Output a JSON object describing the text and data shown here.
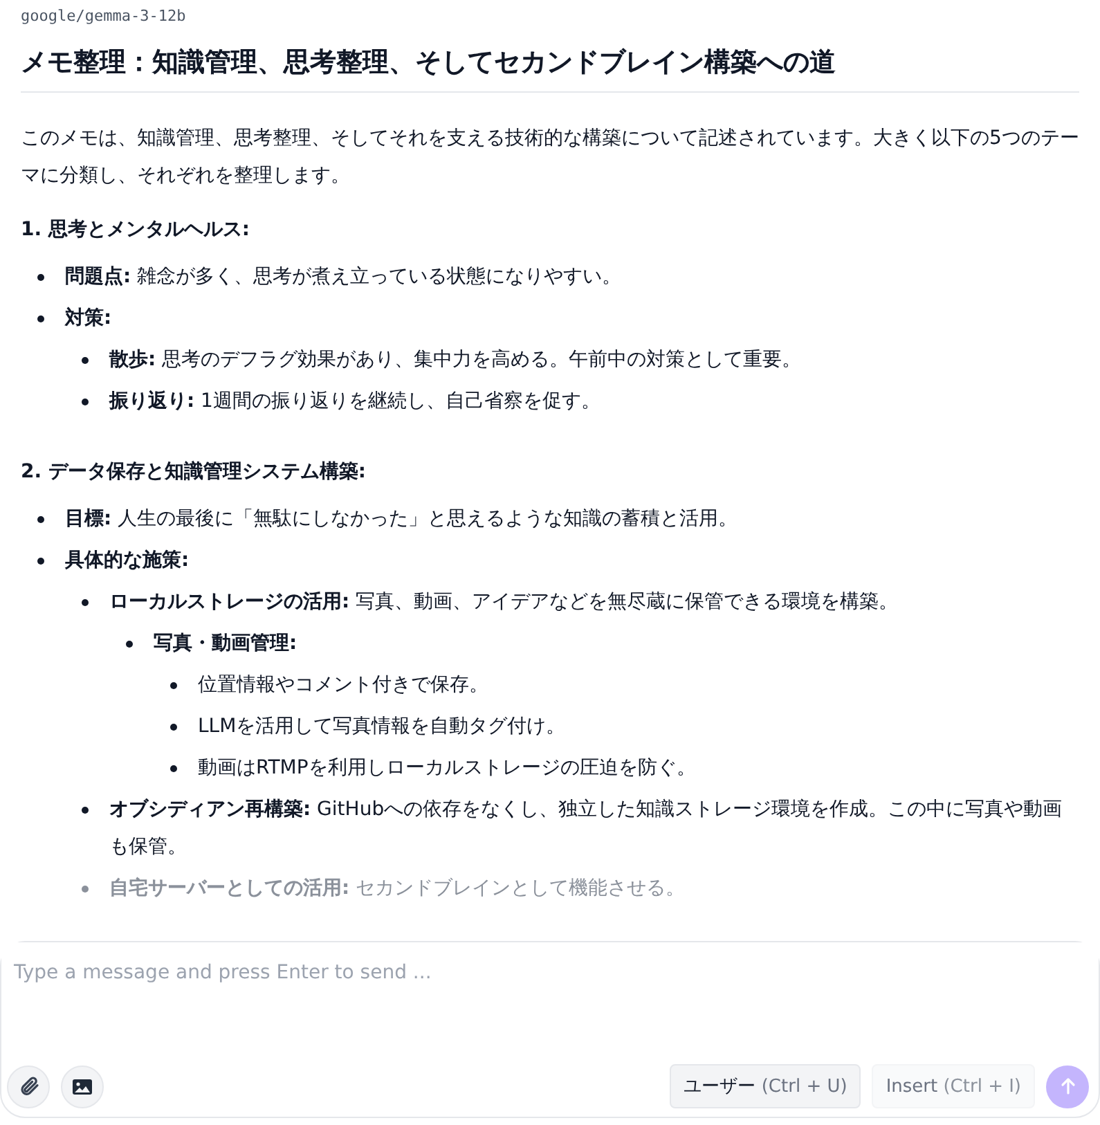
{
  "model": "google/gemma-3-12b",
  "title": "メモ整理：知識管理、思考整理、そしてセカンドブレイン構築への道",
  "intro": "このメモは、知識管理、思考整理、そしてそれを支える技術的な構築について記述されています。大きく以下の5つのテーマに分類し、それぞれを整理します。",
  "sections": [
    {
      "heading": "1. 思考とメンタルヘルス:",
      "items": [
        {
          "text": "**問題点:** 雑念が多く、思考が煮え立っている状態になりやすい。",
          "faded": false
        },
        {
          "text": "**対策:**",
          "faded": false,
          "children": [
            {
              "text": "**散歩:** 思考のデフラグ効果があり、集中力を高める。午前中の対策として重要。",
              "faded": false
            },
            {
              "text": "**振り返り:** 1週間の振り返りを継続し、自己省察を促す。",
              "faded": false
            }
          ]
        }
      ]
    },
    {
      "heading": "2. データ保存と知識管理システム構築:",
      "items": [
        {
          "text": "**目標:** 人生の最後に「無駄にしなかった」と思えるような知識の蓄積と活用。",
          "faded": false
        },
        {
          "text": "**具体的な施策:**",
          "faded": false,
          "children": [
            {
              "text": "**ローカルストレージの活用:** 写真、動画、アイデアなどを無尽蔵に保管できる環境を構築。",
              "faded": false,
              "children": [
                {
                  "text": "**写真・動画管理:**",
                  "faded": false,
                  "children": [
                    {
                      "text": "位置情報やコメント付きで保存。",
                      "faded": false
                    },
                    {
                      "text": "LLMを活用して写真情報を自動タグ付け。",
                      "faded": false
                    },
                    {
                      "text": "動画はRTMPを利用しローカルストレージの圧迫を防ぐ。",
                      "faded": false
                    }
                  ]
                }
              ]
            },
            {
              "text": "**オブシディアン再構築:** GitHubへの依存をなくし、独立した知識ストレージ環境を作成。この中に写真や動画も保管。",
              "faded": false
            },
            {
              "text": "**自宅サーバーとしての活用:** セカンドブレインとして機能させる。",
              "faded": true
            }
          ]
        }
      ]
    }
  ],
  "composer": {
    "placeholder": "Type a message and press Enter to send ...",
    "role_button": {
      "label": "ユーザー",
      "shortcut": "(Ctrl + U)",
      "disabled": false
    },
    "insert_button": {
      "label": "Insert",
      "shortcut": "(Ctrl + I)",
      "disabled": true
    },
    "send_button": {
      "disabled": true
    }
  }
}
